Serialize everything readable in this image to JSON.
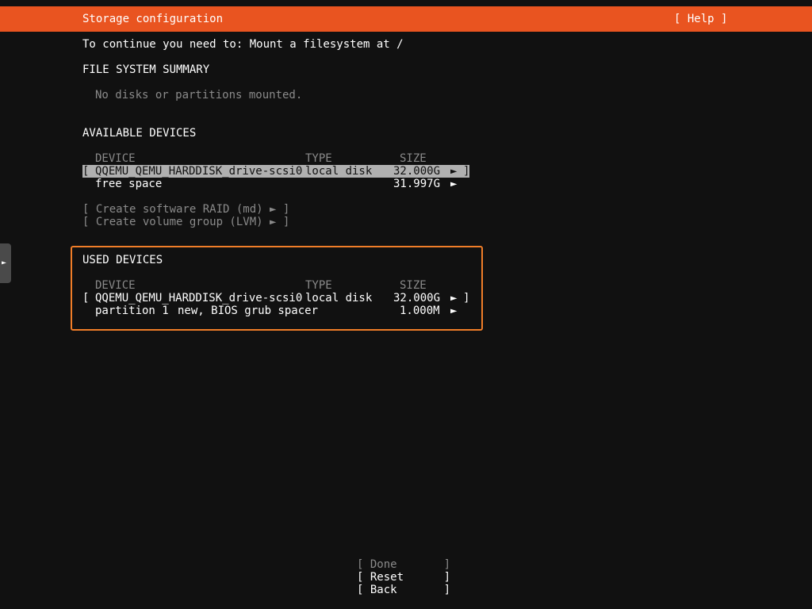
{
  "header": {
    "title": "Storage configuration",
    "help_label": "[ Help ]"
  },
  "instruction": "To continue you need to: Mount a filesystem at /",
  "file_system_summary": {
    "heading": "FILE SYSTEM SUMMARY",
    "empty_text": "No disks or partitions mounted."
  },
  "columns": {
    "device": "DEVICE",
    "type": "TYPE",
    "size": "SIZE"
  },
  "available_devices": {
    "heading": "AVAILABLE DEVICES",
    "rows": [
      {
        "open": "[",
        "device": "QQEMU_QEMU_HARDDISK_drive-scsi0",
        "type": "local disk",
        "size": "32.000G",
        "arrow": "►",
        "close": "]"
      },
      {
        "device": "free space",
        "type": "",
        "size": "31.997G",
        "arrow": "►"
      }
    ],
    "actions": [
      "[ Create software RAID (md) ► ]",
      "[ Create volume group (LVM) ► ]"
    ]
  },
  "used_devices": {
    "heading": "USED DEVICES",
    "rows": [
      {
        "open": "[",
        "device": "QQEMU_QEMU_HARDDISK_drive-scsi0",
        "type": "local disk",
        "size": "32.000G",
        "arrow": "►",
        "close": "]"
      },
      {
        "device": "partition 1",
        "type": "new, BIOS grub spacer",
        "size": "1.000M",
        "arrow": "►"
      }
    ]
  },
  "buttons": {
    "done": "[ Done       ]",
    "reset": "[ Reset      ]",
    "back": "[ Back       ]"
  },
  "side_tab_icon": "►",
  "colors": {
    "header": "#e95420",
    "background": "#111111",
    "highlight": "#b0b0b0",
    "box_border": "#f07d28",
    "dim_text": "#8a8a8a"
  }
}
